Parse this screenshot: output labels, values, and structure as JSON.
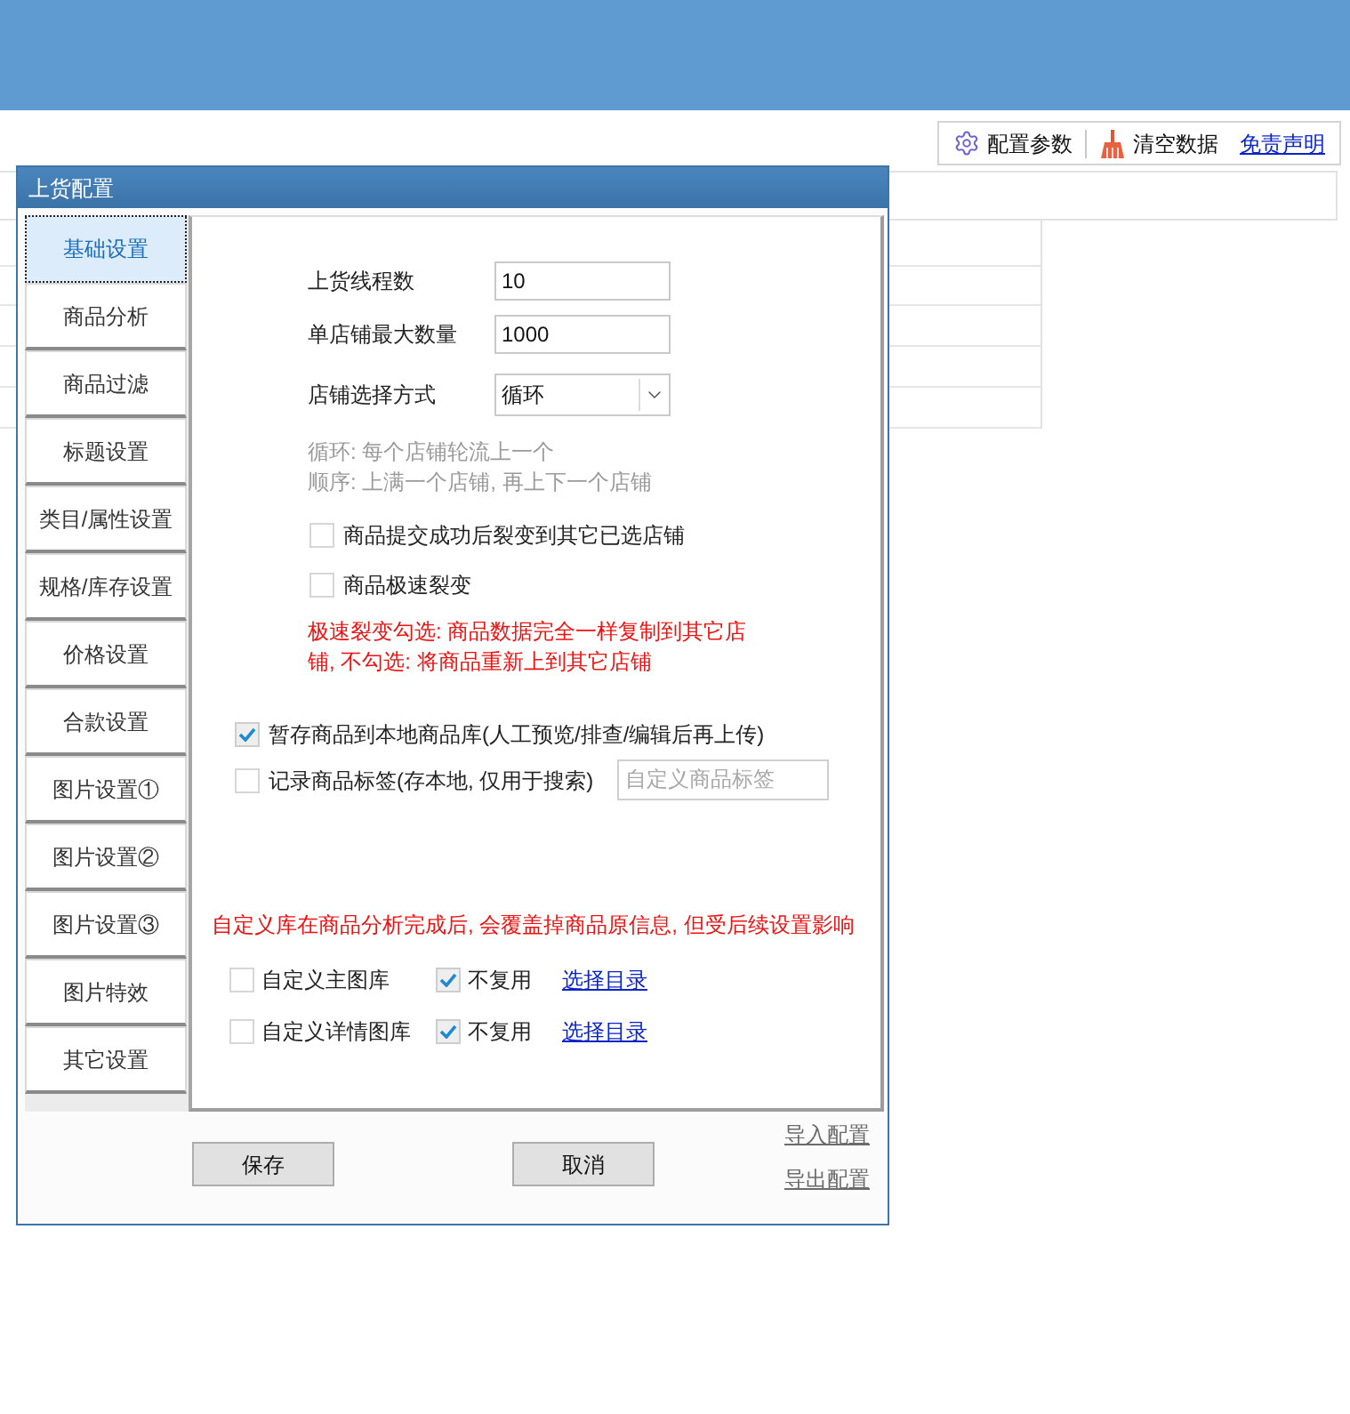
{
  "toolbar": [
    {
      "kind": "button",
      "label": "配置参数"
    },
    {
      "kind": "button",
      "label": "清空数据"
    },
    {
      "kind": "link",
      "label": "免责声明"
    }
  ],
  "dialog": {
    "title": "上货配置",
    "tabs": [
      {
        "label": "基础设置",
        "selected": true
      },
      {
        "label": "商品分析",
        "selected": false
      },
      {
        "label": "商品过滤",
        "selected": false
      },
      {
        "label": "标题设置",
        "selected": false
      },
      {
        "label": "类目/属性设置",
        "selected": false
      },
      {
        "label": "规格/库存设置",
        "selected": false
      },
      {
        "label": "价格设置",
        "selected": false
      },
      {
        "label": "合款设置",
        "selected": false
      },
      {
        "label": "图片设置①",
        "selected": false
      },
      {
        "label": "图片设置②",
        "selected": false
      },
      {
        "label": "图片设置③",
        "selected": false
      },
      {
        "label": "图片特效",
        "selected": false
      },
      {
        "label": "其它设置",
        "selected": false
      }
    ],
    "fields": [
      {
        "kind": "input",
        "label": "上货线程数",
        "value": "10"
      },
      {
        "kind": "input",
        "label": "单店铺最大数量",
        "value": "1000"
      },
      {
        "kind": "select",
        "label": "店铺选择方式",
        "value": "循环"
      }
    ],
    "mode_hints": [
      "循环: 每个店铺轮流上一个",
      "顺序: 上满一个店铺, 再上下一个店铺"
    ],
    "split_options": [
      {
        "label": "商品提交成功后裂变到其它已选店铺",
        "checked": false
      },
      {
        "label": "商品极速裂变",
        "checked": false
      }
    ],
    "split_note": "极速裂变勾选: 商品数据完全一样复制到其它店铺, 不勾选: 将商品重新上到其它店铺",
    "local_options": [
      {
        "label": "暂存商品到本地商品库(人工预览/排查/编辑后再上传)",
        "checked": true
      },
      {
        "label": "记录商品标签(存本地, 仅用于搜索)",
        "checked": false,
        "tag_field": {
          "placeholder": "自定义商品标签"
        }
      }
    ],
    "library_note": "自定义库在商品分析完成后, 会覆盖掉商品原信息, 但受后续设置影响",
    "libraries": [
      {
        "label": "自定义主图库",
        "checked": false,
        "no_reuse": {
          "label": "不复用",
          "checked": true
        },
        "link": "选择目录"
      },
      {
        "label": "自定义详情图库",
        "checked": false,
        "no_reuse": {
          "label": "不复用",
          "checked": true
        },
        "link": "选择目录"
      }
    ],
    "buttons": [
      "保存",
      "取消"
    ],
    "config_links": [
      "导入配置",
      "导出配置"
    ]
  }
}
